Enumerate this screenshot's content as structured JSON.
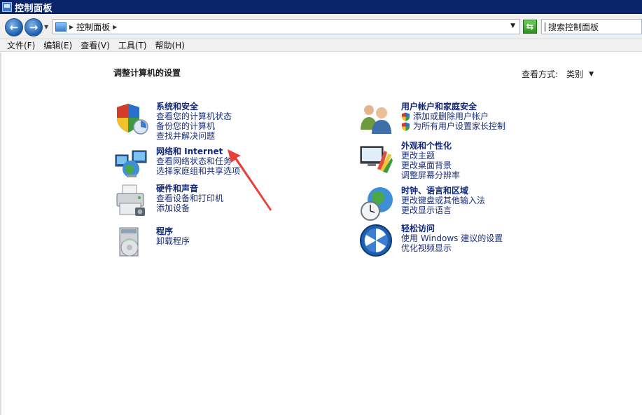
{
  "window": {
    "title": "控制面板"
  },
  "address": {
    "crumbs": [
      "控制面板"
    ],
    "search_placeholder": "搜索控制面板"
  },
  "menu": [
    "文件(F)",
    "编辑(E)",
    "查看(V)",
    "工具(T)",
    "帮助(H)"
  ],
  "main": {
    "heading": "调整计算机的设置",
    "view_by_label": "查看方式:",
    "view_by_value": "类别"
  },
  "categories": {
    "system_security": {
      "title": "系统和安全",
      "links": [
        "查看您的计算机状态",
        "备份您的计算机",
        "查找并解决问题"
      ]
    },
    "network_internet": {
      "title": "网络和 Internet",
      "links": [
        "查看网络状态和任务",
        "选择家庭组和共享选项"
      ]
    },
    "hardware_sound": {
      "title": "硬件和声音",
      "links": [
        "查看设备和打印机",
        "添加设备"
      ]
    },
    "programs": {
      "title": "程序",
      "links": [
        "卸载程序"
      ]
    },
    "user_accounts": {
      "title": "用户帐户和家庭安全",
      "links": [
        "添加或删除用户帐户",
        "为所有用户设置家长控制"
      ]
    },
    "appearance": {
      "title": "外观和个性化",
      "links": [
        "更改主题",
        "更改桌面背景",
        "调整屏幕分辨率"
      ]
    },
    "clock_region": {
      "title": "时钟、语言和区域",
      "links": [
        "更改键盘或其他输入法",
        "更改显示语言"
      ]
    },
    "ease_access": {
      "title": "轻松访问",
      "links": [
        "使用 Windows 建议的设置",
        "优化视频显示"
      ]
    }
  },
  "colors": {
    "titlebar": "#0a246a",
    "category_title": "#10287a",
    "link": "#1c2f7a",
    "annotation_arrow": "#e8413a"
  },
  "icons": {
    "system_security": "shield-icon",
    "network_internet": "network-globe-icon",
    "hardware_sound": "printer-icon",
    "programs": "programs-disc-icon",
    "user_accounts": "users-icon",
    "appearance": "monitor-palette-icon",
    "clock_region": "clock-globe-icon",
    "ease_access": "ease-of-access-icon"
  }
}
